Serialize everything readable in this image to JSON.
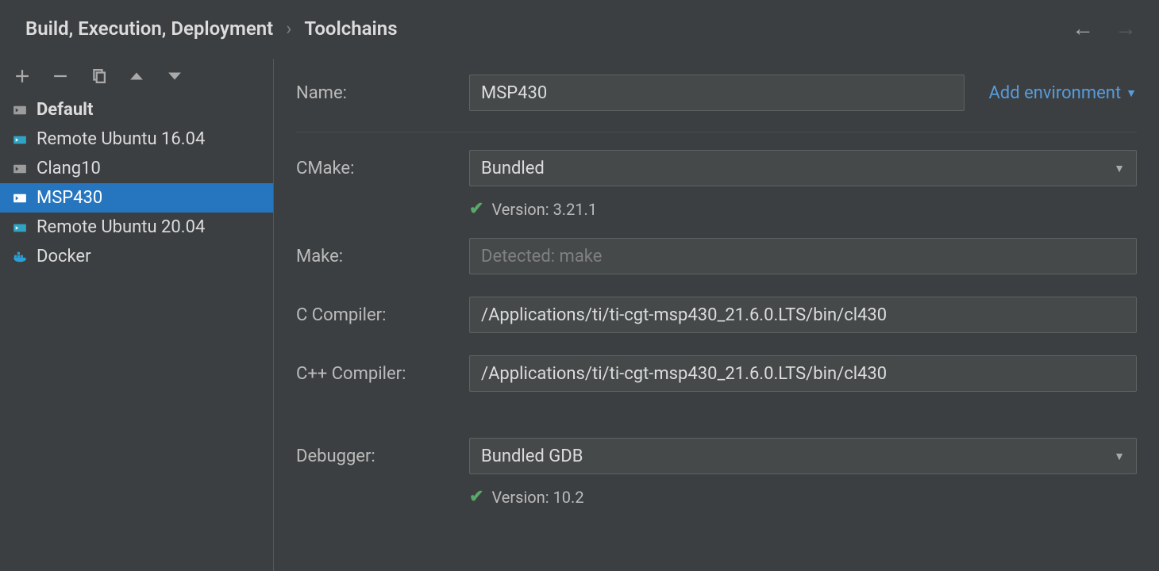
{
  "breadcrumb": {
    "parent": "Build, Execution, Deployment",
    "current": "Toolchains"
  },
  "sidebar": {
    "items": [
      {
        "label": "Default",
        "kind": "local",
        "default": true,
        "selected": false
      },
      {
        "label": "Remote Ubuntu 16.04",
        "kind": "remote",
        "default": false,
        "selected": false
      },
      {
        "label": "Clang10",
        "kind": "local",
        "default": false,
        "selected": false
      },
      {
        "label": "MSP430",
        "kind": "local",
        "default": false,
        "selected": true
      },
      {
        "label": "Remote Ubuntu 20.04",
        "kind": "remote",
        "default": false,
        "selected": false
      },
      {
        "label": "Docker",
        "kind": "docker",
        "default": false,
        "selected": false
      }
    ]
  },
  "form": {
    "name_label": "Name:",
    "name_value": "MSP430",
    "add_env_label": "Add environment",
    "cmake_label": "CMake:",
    "cmake_value": "Bundled",
    "cmake_version": "Version: 3.21.1",
    "make_label": "Make:",
    "make_placeholder": "Detected: make",
    "ccomp_label": "C Compiler:",
    "ccomp_value": "/Applications/ti/ti-cgt-msp430_21.6.0.LTS/bin/cl430",
    "cxxcomp_label": "C++ Compiler:",
    "cxxcomp_value": "/Applications/ti/ti-cgt-msp430_21.6.0.LTS/bin/cl430",
    "debugger_label": "Debugger:",
    "debugger_value": "Bundled GDB",
    "debugger_version": "Version: 10.2"
  }
}
